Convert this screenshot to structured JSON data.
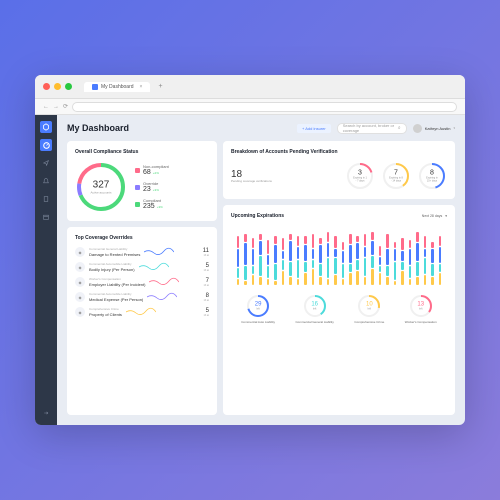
{
  "tab_title": "My Dashboard",
  "page_title": "My Dashboard",
  "add_button": "+ Add insurer",
  "search_placeholder": "Search by account, broker or coverage",
  "user_name": "Kathryn Austin",
  "compliance": {
    "title": "Overall Compliance Status",
    "total": "327",
    "total_label": "Active accounts",
    "legend": [
      {
        "label": "Non-compliant",
        "value": "68",
        "pct": "+2%"
      },
      {
        "label": "Override",
        "value": "23",
        "pct": "+3%"
      },
      {
        "label": "Compliant",
        "value": "235",
        "pct": "+3%"
      }
    ]
  },
  "overrides": {
    "title": "Top Coverage Overrides",
    "items": [
      {
        "cat": "Commercial General Liability",
        "name": "Damage to Rented Premises",
        "count": "11",
        "sub": "13 at"
      },
      {
        "cat": "Commercial Automobile Liability",
        "name": "Bodily Injury (Per Person)",
        "count": "5",
        "sub": "13 at"
      },
      {
        "cat": "Worker's Compensation",
        "name": "Employer Liability (Per Incident)",
        "count": "7",
        "sub": "13 at"
      },
      {
        "cat": "Commercial Automobile Liability",
        "name": "Medical Expense (Per Person)",
        "count": "8",
        "sub": "13 at"
      },
      {
        "cat": "Comprehensive Crime",
        "name": "Property of Clients",
        "count": "5",
        "sub": "13 at"
      }
    ]
  },
  "breakdown": {
    "title": "Breakdown of Accounts Pending Verification",
    "main_num": "18",
    "main_txt": "Pending coverage verifications",
    "rings": [
      {
        "num": "3",
        "txt": "Expiring in 1 - 7 days",
        "color": "#ff6b8a",
        "pct": 20
      },
      {
        "num": "7",
        "txt": "Expiring in 8 - 14 days",
        "color": "#ffc94a",
        "pct": 40
      },
      {
        "num": "8",
        "txt": "Expiring in 15+ days",
        "color": "#4a7cff",
        "pct": 45
      }
    ]
  },
  "expirations": {
    "title": "Upcoming Expirations",
    "filter": "Next 28 days",
    "rings": [
      {
        "num": "29",
        "label": "Commercial Auto Liability",
        "color": "#4a7cff",
        "pct": 70
      },
      {
        "num": "16",
        "label": "Commercial General Liability",
        "color": "#4cdbdb",
        "pct": 40
      },
      {
        "num": "10",
        "label": "Comprehensive Crime",
        "color": "#ffc94a",
        "pct": 28
      },
      {
        "num": "13",
        "label": "Worker's Compensation",
        "color": "#ff6b8a",
        "pct": 35
      }
    ]
  },
  "chart_data": {
    "type": "bar",
    "title": "Upcoming Expirations",
    "series": [
      "pink",
      "blue",
      "cyan",
      "yellow"
    ],
    "columns": [
      [
        12,
        18,
        10,
        6
      ],
      [
        8,
        22,
        14,
        4
      ],
      [
        10,
        16,
        8,
        10
      ],
      [
        6,
        14,
        20,
        8
      ],
      [
        14,
        10,
        12,
        6
      ],
      [
        8,
        18,
        16,
        4
      ],
      [
        12,
        8,
        10,
        14
      ],
      [
        6,
        20,
        14,
        8
      ],
      [
        10,
        12,
        18,
        6
      ],
      [
        8,
        16,
        10,
        12
      ],
      [
        14,
        10,
        8,
        16
      ],
      [
        6,
        18,
        12,
        8
      ],
      [
        10,
        14,
        20,
        6
      ],
      [
        12,
        8,
        16,
        10
      ],
      [
        8,
        12,
        14,
        6
      ],
      [
        10,
        18,
        8,
        12
      ],
      [
        6,
        16,
        10,
        14
      ],
      [
        12,
        10,
        18,
        8
      ],
      [
        8,
        14,
        12,
        16
      ],
      [
        10,
        8,
        6,
        12
      ],
      [
        14,
        16,
        10,
        8
      ],
      [
        6,
        12,
        18,
        4
      ],
      [
        12,
        10,
        8,
        14
      ],
      [
        8,
        16,
        12,
        6
      ],
      [
        10,
        18,
        14,
        8
      ],
      [
        12,
        8,
        16,
        10
      ],
      [
        6,
        14,
        12,
        8
      ],
      [
        10,
        16,
        8,
        12
      ]
    ]
  }
}
